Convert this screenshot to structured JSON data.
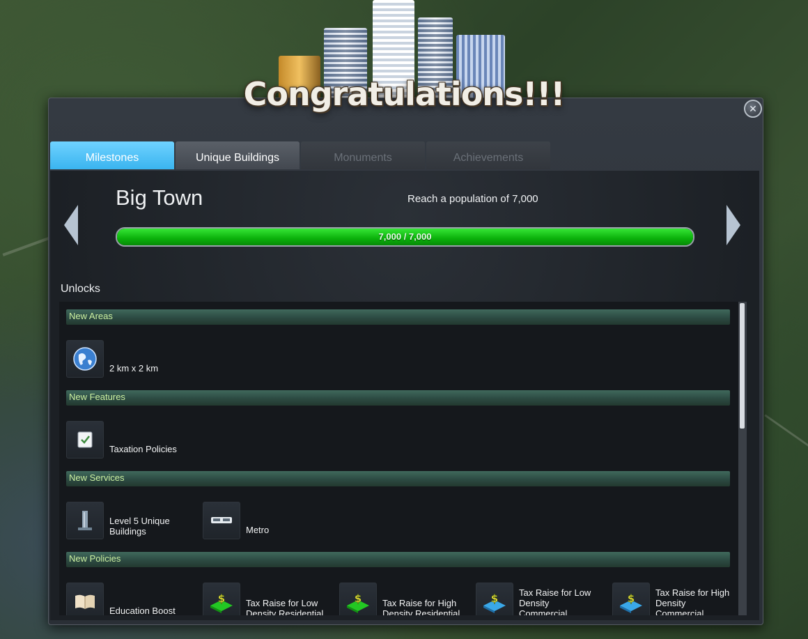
{
  "header": {
    "title": "Congratulations!!!",
    "close_icon": "close-icon"
  },
  "tabs": [
    {
      "label": "Milestones",
      "state": "active"
    },
    {
      "label": "Unique Buildings",
      "state": "normal"
    },
    {
      "label": "Monuments",
      "state": "disabled"
    },
    {
      "label": "Achievements",
      "state": "disabled"
    }
  ],
  "milestone": {
    "name": "Big Town",
    "goal": "Reach a population of 7,000",
    "progress_text": "7,000 / 7,000",
    "progress_fraction": 1.0
  },
  "unlocks": {
    "label": "Unlocks",
    "sections": [
      {
        "title": "New Areas",
        "items": [
          {
            "label": "2 km x 2 km",
            "icon": "globe-icon"
          }
        ]
      },
      {
        "title": "New Features",
        "items": [
          {
            "label": "Taxation Policies",
            "icon": "checkbox-icon"
          }
        ]
      },
      {
        "title": "New Services",
        "items": [
          {
            "label": "Level 5 Unique Buildings",
            "icon": "tower-icon"
          },
          {
            "label": "Metro",
            "icon": "metro-train-icon"
          }
        ]
      },
      {
        "title": "New Policies",
        "items": [
          {
            "label": "Education Boost",
            "icon": "book-icon"
          },
          {
            "label": "Tax Raise for Low Density Residential",
            "icon": "tax-residential-icon"
          },
          {
            "label": "Tax Raise for High Density Residential",
            "icon": "tax-residential-icon"
          },
          {
            "label": "Tax Raise for Low Density Commercial",
            "icon": "tax-commercial-icon"
          },
          {
            "label": "Tax Raise for High Density Commercial",
            "icon": "tax-commercial-icon"
          }
        ]
      }
    ]
  },
  "colors": {
    "active_tab": "#3ab4ef",
    "progress_fill": "#0ab00a",
    "section_label": "#cdf2a2"
  }
}
